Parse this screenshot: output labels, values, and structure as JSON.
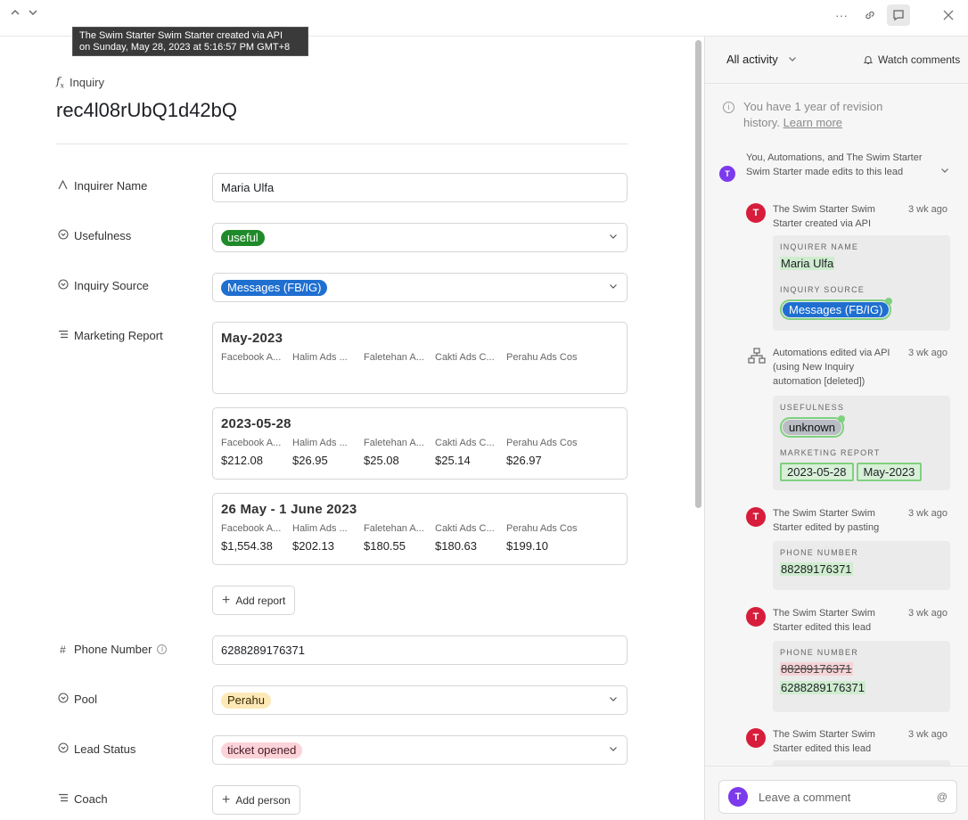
{
  "tooltip": {
    "line1": "The Swim Starter Swim Starter created via API",
    "line2": "on Sunday, May 28, 2023 at 5:16:57 PM GMT+8"
  },
  "record": {
    "type": "Inquiry",
    "title": "rec4l08rUbQ1d42bQ"
  },
  "fields": {
    "inquirer_name": {
      "label": "Inquirer Name",
      "value": "Maria Ulfa"
    },
    "usefulness": {
      "label": "Usefulness",
      "value": "useful",
      "color": "#1f8a2a"
    },
    "inquiry_source": {
      "label": "Inquiry Source",
      "value": "Messages (FB/IG)",
      "color": "#1f6fd0"
    },
    "marketing_report": {
      "label": "Marketing Report",
      "columns": [
        "Facebook A...",
        "Halim Ads ...",
        "Faletehan A...",
        "Cakti Ads C...",
        "Perahu Ads Cost"
      ],
      "reports": [
        {
          "title": "May-2023",
          "values": [
            "",
            "",
            "",
            "",
            ""
          ]
        },
        {
          "title": "2023-05-28",
          "values": [
            "$212.08",
            "$26.95",
            "$25.08",
            "$25.14",
            "$26.97"
          ]
        },
        {
          "title": "26 May - 1 June 2023",
          "values": [
            "$1,554.38",
            "$202.13",
            "$180.55",
            "$180.63",
            "$199.10"
          ]
        }
      ],
      "add_label": "Add report"
    },
    "phone_number": {
      "label": "Phone Number",
      "value": "6288289176371"
    },
    "pool": {
      "label": "Pool",
      "value": "Perahu",
      "color": "#fde9b8"
    },
    "lead_status": {
      "label": "Lead Status",
      "value": "ticket opened",
      "color": "#fbd3d9"
    },
    "coach": {
      "label": "Coach",
      "add_label": "Add person"
    }
  },
  "panel": {
    "filter": "All activity",
    "watch": "Watch comments",
    "revision_text": "You have 1 year of revision history.",
    "learn_more": "Learn more",
    "summary": "You, Automations, and The Swim Starter Swim Starter made edits to this lead",
    "summary_avatar": "T",
    "activities": [
      {
        "avatar": "T",
        "text": "The Swim Starter Swim Starter created via API",
        "time": "3 wk ago",
        "changes": [
          {
            "label": "INQUIRER NAME",
            "added": "Maria Ulfa"
          },
          {
            "label": "INQUIRY SOURCE",
            "added_pill": "Messages (FB/IG)"
          }
        ]
      },
      {
        "text": "Automations edited via API (using New Inquiry automation [deleted])",
        "time": "3 wk ago",
        "changes": [
          {
            "label": "USEFULNESS",
            "added_pill": "unknown"
          },
          {
            "label": "MARKETING REPORT",
            "records": [
              "2023-05-28",
              "May-2023"
            ]
          }
        ]
      },
      {
        "avatar": "T",
        "text": "The Swim Starter Swim Starter edited by pasting",
        "time": "3 wk ago",
        "changes": [
          {
            "label": "PHONE NUMBER",
            "added": "88289176371"
          }
        ]
      },
      {
        "avatar": "T",
        "text": "The Swim Starter Swim Starter edited this lead",
        "time": "3 wk ago",
        "changes": [
          {
            "label": "PHONE NUMBER",
            "removed": "88289176371",
            "added": "6288289176371"
          }
        ]
      },
      {
        "avatar": "T",
        "text": "The Swim Starter Swim Starter edited this lead",
        "time": "3 wk ago"
      }
    ],
    "comment_placeholder": "Leave a comment",
    "comment_avatar": "T",
    "at_symbol": "@"
  }
}
